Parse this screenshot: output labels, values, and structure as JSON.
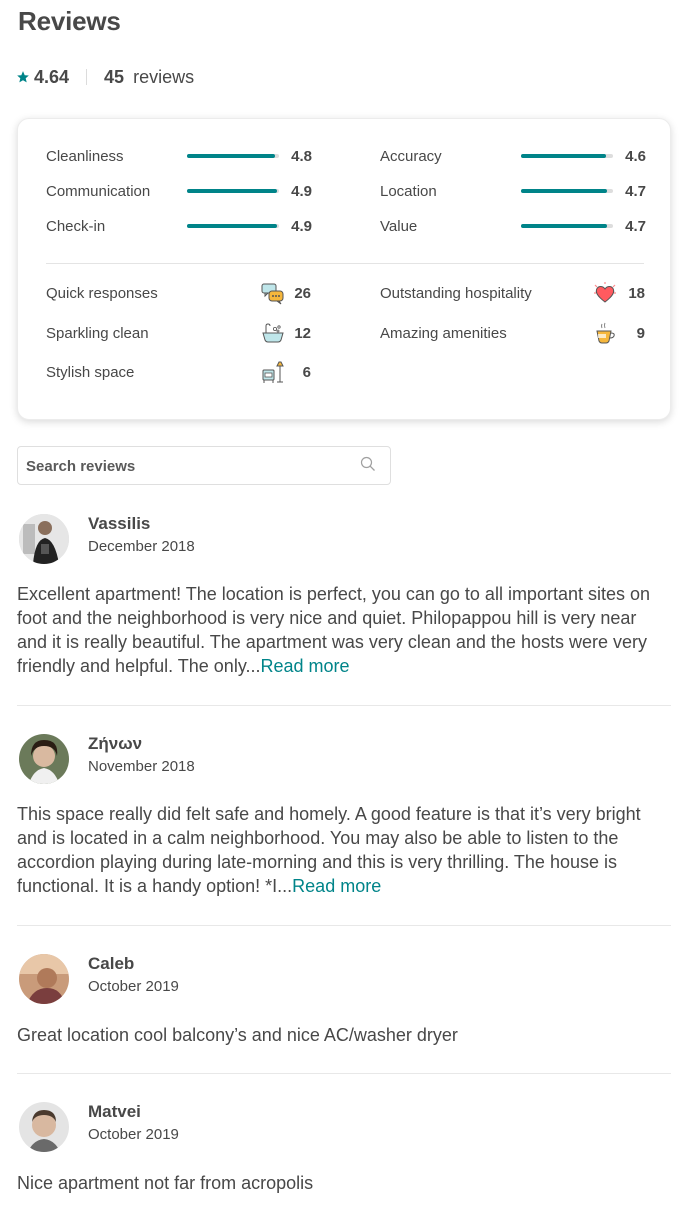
{
  "title": "Reviews",
  "summary": {
    "rating": "4.64",
    "count": "45",
    "count_label": "reviews"
  },
  "accent_color": "#008489",
  "categories": [
    {
      "label": "Cleanliness",
      "value": "4.8",
      "score": 4.8
    },
    {
      "label": "Accuracy",
      "value": "4.6",
      "score": 4.6
    },
    {
      "label": "Communication",
      "value": "4.9",
      "score": 4.9
    },
    {
      "label": "Location",
      "value": "4.7",
      "score": 4.7
    },
    {
      "label": "Check-in",
      "value": "4.9",
      "score": 4.9
    },
    {
      "label": "Value",
      "value": "4.7",
      "score": 4.7
    }
  ],
  "highlights": [
    {
      "label": "Quick responses",
      "count": "26",
      "icon": "chat-bubbles-icon"
    },
    {
      "label": "Outstanding hospitality",
      "count": "18",
      "icon": "heart-icon"
    },
    {
      "label": "Sparkling clean",
      "count": "12",
      "icon": "bathtub-icon"
    },
    {
      "label": "Amazing amenities",
      "count": "9",
      "icon": "coffee-cup-icon"
    },
    {
      "label": "Stylish space",
      "count": "6",
      "icon": "lamp-chair-icon"
    }
  ],
  "search": {
    "placeholder": "Search reviews"
  },
  "reviews": [
    {
      "name": "Vassilis",
      "date": "December 2018",
      "text": "Excellent apartment! The location is perfect, you can go to all important sites on foot and the neighborhood is very nice and quiet. Philopappou hill is very near and it is really beautiful. The apartment was very clean and the hosts were very friendly and helpful. The only...",
      "more": "Read more"
    },
    {
      "name": "Ζήνων",
      "date": "November 2018",
      "text": "This space really did felt safe and homely. A good feature is that it’s very bright and is located in a calm neighborhood. You may also be able to listen to the accordion playing during late-morning and this is very thrilling. The house is functional. It is a handy option! *I...",
      "more": "Read more"
    },
    {
      "name": "Caleb",
      "date": "October 2019",
      "text": "Great location cool balcony’s and nice AC/washer dryer"
    },
    {
      "name": "Matvei",
      "date": "October 2019",
      "text": "Nice apartment not far from acropolis"
    }
  ]
}
